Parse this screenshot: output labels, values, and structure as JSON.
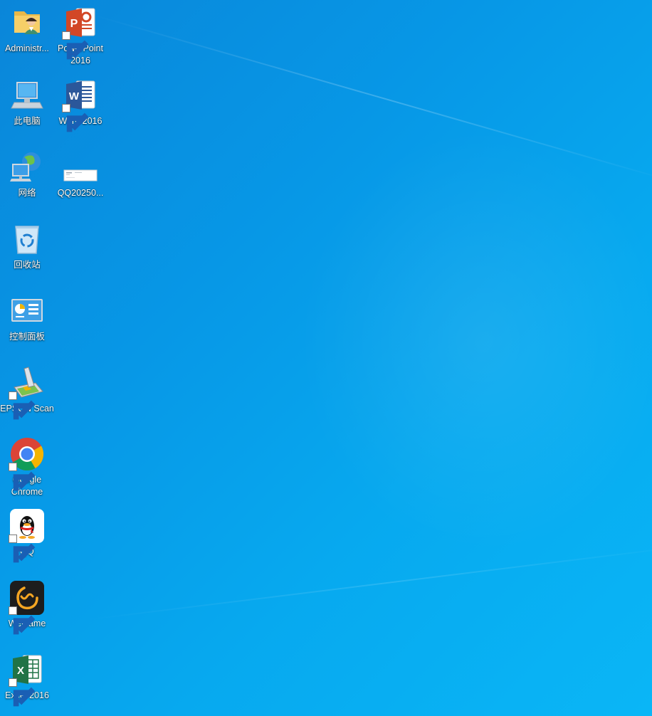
{
  "desktop": {
    "background_color": "#0797e6",
    "icons": [
      {
        "id": "administrator",
        "label": "Administr...",
        "icon": "user-folder-icon",
        "shortcut": false
      },
      {
        "id": "powerpoint",
        "label": "PowerPoint\n2016",
        "icon": "powerpoint-icon",
        "shortcut": true
      },
      {
        "id": "this-pc",
        "label": "此电脑",
        "icon": "computer-icon",
        "shortcut": false
      },
      {
        "id": "word",
        "label": "Word 2016",
        "icon": "word-icon",
        "shortcut": true
      },
      {
        "id": "network",
        "label": "网络",
        "icon": "network-icon",
        "shortcut": false
      },
      {
        "id": "qq-screenshot",
        "label": "QQ20250...",
        "icon": "image-file-icon",
        "shortcut": false
      },
      {
        "id": "recycle-bin",
        "label": "回收站",
        "icon": "recycle-bin-icon",
        "shortcut": false
      },
      {
        "id": "control-panel",
        "label": "控制面板",
        "icon": "control-panel-icon",
        "shortcut": false
      },
      {
        "id": "epson-scan",
        "label": "EPSON Scan",
        "icon": "scanner-icon",
        "shortcut": true
      },
      {
        "id": "google-chrome",
        "label": "Google\nChrome",
        "icon": "chrome-icon",
        "shortcut": true
      },
      {
        "id": "qq",
        "label": "QQ",
        "icon": "qq-penguin-icon",
        "shortcut": true
      },
      {
        "id": "wegame",
        "label": "WeGame",
        "icon": "wegame-icon",
        "shortcut": true
      },
      {
        "id": "excel",
        "label": "Excel 2016",
        "icon": "excel-icon",
        "shortcut": true
      }
    ]
  }
}
